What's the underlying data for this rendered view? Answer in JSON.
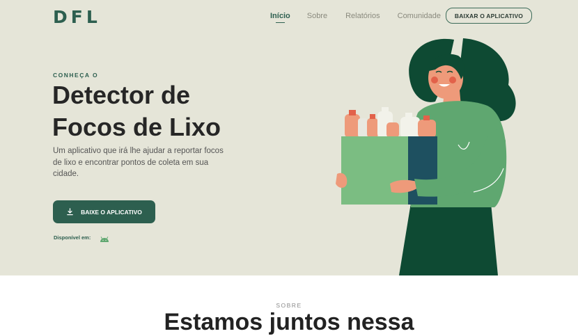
{
  "header": {
    "logo": "DFL",
    "nav": [
      {
        "label": "Início",
        "active": true
      },
      {
        "label": "Sobre",
        "active": false
      },
      {
        "label": "Relatórios",
        "active": false
      },
      {
        "label": "Comunidade",
        "active": false
      }
    ],
    "cta_label": "BAIXAR O APLICATIVO"
  },
  "hero": {
    "eyebrow": "CONHEÇA O",
    "title": "Detector de Focos de Lixo",
    "description": "Um aplicativo que irá lhe ajudar a reportar focos de lixo e encontrar pontos de coleta em sua cidade.",
    "button_label": "BAIXE O APLICATIVO",
    "button_icon": "download-icon",
    "available_label": "Disponível em:",
    "available_icon": "android-icon"
  },
  "about": {
    "label": "SOBRE",
    "title": "Estamos juntos nessa"
  },
  "colors": {
    "brand": "#2d5f4f",
    "hero_background": "#e5e5d8",
    "accent_green": "#5fa770",
    "skin": "#ee9a7a"
  }
}
